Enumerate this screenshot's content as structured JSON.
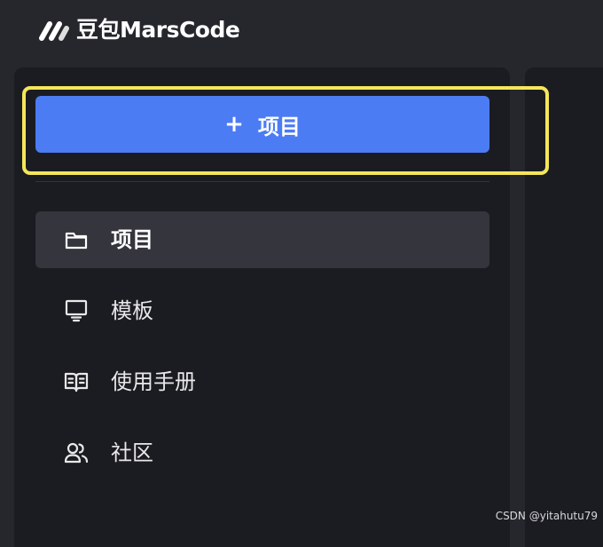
{
  "app": {
    "logo_text": "豆包MarsCode",
    "logo_icon": "marscode-logo"
  },
  "sidebar": {
    "new_button": {
      "icon": "plus-icon",
      "label": "项目"
    },
    "nav": [
      {
        "label": "项目",
        "icon": "folder-icon",
        "active": true
      },
      {
        "label": "模板",
        "icon": "monitor-icon",
        "active": false
      },
      {
        "label": "使用手册",
        "icon": "book-icon",
        "active": false
      },
      {
        "label": "社区",
        "icon": "users-icon",
        "active": false
      }
    ]
  },
  "watermark": "CSDN @yitahutu79",
  "colors": {
    "background": "#26272c",
    "panel": "#1b1c21",
    "primary_button": "#4b7cf3",
    "active_nav": "#34353d",
    "highlight": "#f5e65a"
  }
}
